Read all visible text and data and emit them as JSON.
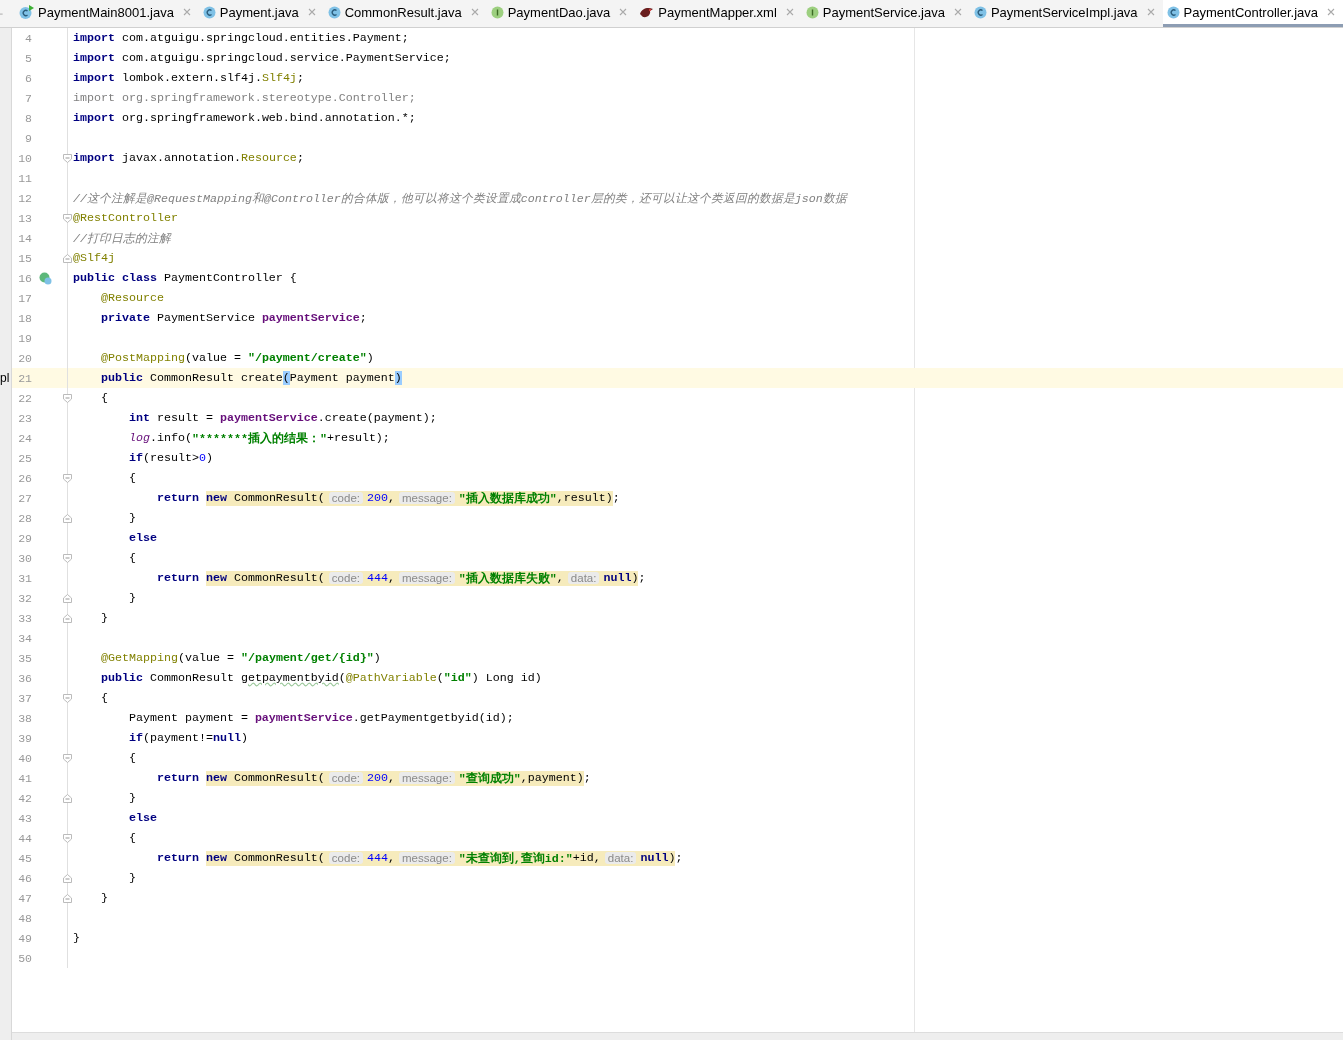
{
  "tabs": [
    {
      "label": "PaymentMain8001.java",
      "kind": "run",
      "selected": false
    },
    {
      "label": "Payment.java",
      "kind": "class",
      "selected": false
    },
    {
      "label": "CommonResult.java",
      "kind": "class",
      "selected": false
    },
    {
      "label": "PaymentDao.java",
      "kind": "interface",
      "selected": false
    },
    {
      "label": "PaymentMapper.xml",
      "kind": "xml",
      "selected": false
    },
    {
      "label": "PaymentService.java",
      "kind": "interface",
      "selected": false
    },
    {
      "label": "PaymentServiceImpl.java",
      "kind": "class",
      "selected": false
    },
    {
      "label": "PaymentController.java",
      "kind": "class",
      "selected": true
    }
  ],
  "editor": {
    "lines": [
      {
        "number": "4",
        "current": false,
        "tokens": [
          {
            "kind": "kw",
            "text": "import"
          },
          {
            "kind": "plain",
            "text": " com.atguigu.springcloud.entities.Payment;"
          }
        ]
      },
      {
        "number": "5",
        "current": false,
        "tokens": [
          {
            "kind": "kw",
            "text": "import"
          },
          {
            "kind": "plain",
            "text": " com.atguigu.springcloud.service.PaymentService;"
          }
        ]
      },
      {
        "number": "6",
        "current": false,
        "tokens": [
          {
            "kind": "kw",
            "text": "import"
          },
          {
            "kind": "plain",
            "text": " lombok.extern.slf4j."
          },
          {
            "kind": "ann",
            "text": "Slf4j"
          },
          {
            "kind": "plain",
            "text": ";"
          }
        ]
      },
      {
        "number": "7",
        "current": false,
        "tokens": [
          {
            "kind": "unused",
            "text": "import org.springframework.stereotype.Controller;"
          }
        ]
      },
      {
        "number": "8",
        "current": false,
        "tokens": [
          {
            "kind": "kw",
            "text": "import"
          },
          {
            "kind": "plain",
            "text": " org.springframework.web.bind.annotation.*;"
          }
        ]
      },
      {
        "number": "9",
        "current": false
      },
      {
        "number": "10",
        "current": false,
        "kind": "fold_start",
        "tokens": [
          {
            "kind": "kw",
            "text": "import"
          },
          {
            "kind": "plain",
            "text": " javax.annotation."
          },
          {
            "kind": "ann",
            "text": "Resource"
          },
          {
            "kind": "plain",
            "text": ";"
          }
        ]
      },
      {
        "number": "11",
        "current": false
      },
      {
        "number": "12",
        "current": false,
        "tokens": [
          {
            "kind": "comment",
            "text": "//这个注解是@RequestMapping和@Controller的合体版，他可以将这个类设置成controller层的类，还可以让这个类返回的数据是json数据"
          }
        ]
      },
      {
        "number": "13",
        "current": false,
        "kind": "fold_start",
        "tokens": [
          {
            "kind": "ann",
            "text": "@RestController"
          }
        ]
      },
      {
        "number": "14",
        "current": false,
        "tokens": [
          {
            "kind": "comment",
            "text": "//打印日志的注解"
          }
        ]
      },
      {
        "number": "15",
        "current": false,
        "kind": "fold_end",
        "tokens": [
          {
            "kind": "ann",
            "text": "@Slf4j"
          }
        ]
      },
      {
        "number": "16",
        "current": false,
        "kind": "class",
        "tokens": [
          {
            "kind": "kw",
            "text": "public class"
          },
          {
            "kind": "plain",
            "text": " PaymentController {"
          }
        ]
      },
      {
        "number": "17",
        "current": false,
        "tokens": [
          {
            "kind": "ann",
            "text": "    @Resource"
          }
        ]
      },
      {
        "number": "18",
        "current": false,
        "tokens": [
          {
            "kind": "kw",
            "text": "    private"
          },
          {
            "kind": "plain",
            "text": " PaymentService "
          },
          {
            "kind": "field",
            "text": "paymentService"
          },
          {
            "kind": "plain",
            "text": ";"
          }
        ]
      },
      {
        "number": "19",
        "current": false
      },
      {
        "number": "20",
        "current": false,
        "tokens": [
          {
            "kind": "ann",
            "text": "    @PostMapping"
          },
          {
            "kind": "plain",
            "text": "(value = "
          },
          {
            "kind": "str",
            "text": "\"/payment/create\""
          },
          {
            "kind": "plain",
            "text": ")"
          }
        ]
      },
      {
        "number": "21",
        "current": true,
        "side_text": "pl",
        "tokens": [
          {
            "kind": "kw",
            "text": "    public"
          },
          {
            "kind": "plain",
            "text": " CommonResult create"
          },
          {
            "kind": "brace",
            "text": "("
          },
          {
            "kind": "plain",
            "text": "Payment payment"
          },
          {
            "kind": "brace",
            "text": ")"
          }
        ]
      },
      {
        "number": "22",
        "current": false,
        "kind": "fold_start",
        "tokens": [
          {
            "kind": "plain",
            "text": "    {"
          }
        ]
      },
      {
        "number": "23",
        "current": false,
        "tokens": [
          {
            "kind": "kw",
            "text": "        int"
          },
          {
            "kind": "plain",
            "text": " result = "
          },
          {
            "kind": "field",
            "text": "paymentService"
          },
          {
            "kind": "plain",
            "text": ".create(payment);"
          }
        ]
      },
      {
        "number": "24",
        "current": false,
        "tokens": [
          {
            "kind": "static",
            "text": "        log"
          },
          {
            "kind": "plain",
            "text": ".info("
          },
          {
            "kind": "str",
            "text": "\"*******插入的结果：\""
          },
          {
            "kind": "plain",
            "text": "+result);"
          }
        ]
      },
      {
        "number": "25",
        "current": false,
        "tokens": [
          {
            "kind": "kw",
            "text": "        if"
          },
          {
            "kind": "plain",
            "text": "(result>"
          },
          {
            "kind": "num",
            "text": "0"
          },
          {
            "kind": "plain",
            "text": ")"
          }
        ]
      },
      {
        "number": "26",
        "current": false,
        "kind": "fold_start",
        "tokens": [
          {
            "kind": "plain",
            "text": "        {"
          }
        ]
      },
      {
        "number": "27",
        "current": false,
        "tokens": [
          {
            "kind": "kw",
            "text": "            return "
          },
          {
            "kind": "group",
            "tokens": [
              {
                "kind": "kw",
                "text": "new"
              },
              {
                "kind": "plain",
                "text": " CommonResult("
              },
              {
                "kind": "hint",
                "text": "code:"
              },
              {
                "kind": "num",
                "text": "200"
              },
              {
                "kind": "plain",
                "text": ","
              },
              {
                "kind": "hint",
                "text": "message:"
              },
              {
                "kind": "str",
                "text": "\"插入数据库成功\""
              },
              {
                "kind": "plain",
                "text": ",result)"
              }
            ]
          },
          {
            "kind": "plain",
            "text": ";"
          }
        ]
      },
      {
        "number": "28",
        "current": false,
        "kind": "fold_end",
        "tokens": [
          {
            "kind": "plain",
            "text": "        }"
          }
        ]
      },
      {
        "number": "29",
        "current": false,
        "tokens": [
          {
            "kind": "kw",
            "text": "        else"
          }
        ]
      },
      {
        "number": "30",
        "current": false,
        "kind": "fold_start",
        "tokens": [
          {
            "kind": "plain",
            "text": "        {"
          }
        ]
      },
      {
        "number": "31",
        "current": false,
        "tokens": [
          {
            "kind": "kw",
            "text": "            return "
          },
          {
            "kind": "group",
            "tokens": [
              {
                "kind": "kw",
                "text": "new"
              },
              {
                "kind": "plain",
                "text": " CommonResult("
              },
              {
                "kind": "hint",
                "text": "code:"
              },
              {
                "kind": "num",
                "text": "444"
              },
              {
                "kind": "plain",
                "text": ","
              },
              {
                "kind": "hint",
                "text": "message:"
              },
              {
                "kind": "str",
                "text": "\"插入数据库失败\""
              },
              {
                "kind": "plain",
                "text": ","
              },
              {
                "kind": "hint",
                "text": "data:"
              },
              {
                "kind": "kw",
                "text": "null"
              },
              {
                "kind": "plain",
                "text": ")"
              }
            ]
          },
          {
            "kind": "plain",
            "text": ";"
          }
        ]
      },
      {
        "number": "32",
        "current": false,
        "kind": "fold_end",
        "tokens": [
          {
            "kind": "plain",
            "text": "        }"
          }
        ]
      },
      {
        "number": "33",
        "current": false,
        "kind": "fold_end",
        "tokens": [
          {
            "kind": "plain",
            "text": "    }"
          }
        ]
      },
      {
        "number": "34",
        "current": false
      },
      {
        "number": "35",
        "current": false,
        "tokens": [
          {
            "kind": "ann",
            "text": "    @GetMapping"
          },
          {
            "kind": "plain",
            "text": "(value = "
          },
          {
            "kind": "str",
            "text": "\"/payment/get/{id}\""
          },
          {
            "kind": "plain",
            "text": ")"
          }
        ]
      },
      {
        "number": "36",
        "current": false,
        "tokens": [
          {
            "kind": "kw",
            "text": "    public"
          },
          {
            "kind": "plain",
            "text": " CommonResult "
          },
          {
            "kind": "typo",
            "text": "getpaymentbyid"
          },
          {
            "kind": "plain",
            "text": "("
          },
          {
            "kind": "ann",
            "text": "@PathVariable"
          },
          {
            "kind": "plain",
            "text": "("
          },
          {
            "kind": "str",
            "text": "\"id\""
          },
          {
            "kind": "plain",
            "text": ") Long id)"
          }
        ]
      },
      {
        "number": "37",
        "current": false,
        "kind": "fold_start",
        "tokens": [
          {
            "kind": "plain",
            "text": "    {"
          }
        ]
      },
      {
        "number": "38",
        "current": false,
        "tokens": [
          {
            "kind": "plain",
            "text": "        Payment payment = "
          },
          {
            "kind": "field",
            "text": "paymentService"
          },
          {
            "kind": "plain",
            "text": ".getPaymentgetbyid(id);"
          }
        ]
      },
      {
        "number": "39",
        "current": false,
        "tokens": [
          {
            "kind": "kw",
            "text": "        if"
          },
          {
            "kind": "plain",
            "text": "(payment!="
          },
          {
            "kind": "kw",
            "text": "null"
          },
          {
            "kind": "plain",
            "text": ")"
          }
        ]
      },
      {
        "number": "40",
        "current": false,
        "kind": "fold_start",
        "tokens": [
          {
            "kind": "plain",
            "text": "        {"
          }
        ]
      },
      {
        "number": "41",
        "current": false,
        "tokens": [
          {
            "kind": "kw",
            "text": "            return "
          },
          {
            "kind": "group",
            "tokens": [
              {
                "kind": "kw",
                "text": "new"
              },
              {
                "kind": "plain",
                "text": " CommonResult("
              },
              {
                "kind": "hint",
                "text": "code:"
              },
              {
                "kind": "num",
                "text": "200"
              },
              {
                "kind": "plain",
                "text": ","
              },
              {
                "kind": "hint",
                "text": "message:"
              },
              {
                "kind": "str",
                "text": "\"查询成功\""
              },
              {
                "kind": "plain",
                "text": ",payment)"
              }
            ]
          },
          {
            "kind": "plain",
            "text": ";"
          }
        ]
      },
      {
        "number": "42",
        "current": false,
        "kind": "fold_end",
        "tokens": [
          {
            "kind": "plain",
            "text": "        }"
          }
        ]
      },
      {
        "number": "43",
        "current": false,
        "tokens": [
          {
            "kind": "kw",
            "text": "        else"
          }
        ]
      },
      {
        "number": "44",
        "current": false,
        "kind": "fold_start",
        "tokens": [
          {
            "kind": "plain",
            "text": "        {"
          }
        ]
      },
      {
        "number": "45",
        "current": false,
        "tokens": [
          {
            "kind": "kw",
            "text": "            return "
          },
          {
            "kind": "group",
            "tokens": [
              {
                "kind": "kw",
                "text": "new"
              },
              {
                "kind": "plain",
                "text": " CommonResult("
              },
              {
                "kind": "hint",
                "text": "code:"
              },
              {
                "kind": "num",
                "text": "444"
              },
              {
                "kind": "plain",
                "text": ","
              },
              {
                "kind": "hint",
                "text": "message:"
              },
              {
                "kind": "str",
                "text": "\"未查询到,查询id:\""
              },
              {
                "kind": "plain",
                "text": "+id,"
              },
              {
                "kind": "hint",
                "text": "data:"
              },
              {
                "kind": "kw",
                "text": "null"
              },
              {
                "kind": "plain",
                "text": ")"
              }
            ]
          },
          {
            "kind": "plain",
            "text": ";"
          }
        ]
      },
      {
        "number": "46",
        "current": false,
        "kind": "fold_end",
        "tokens": [
          {
            "kind": "plain",
            "text": "        }"
          }
        ]
      },
      {
        "number": "47",
        "current": false,
        "kind": "fold_end",
        "tokens": [
          {
            "kind": "plain",
            "text": "    }"
          }
        ]
      },
      {
        "number": "48",
        "current": false
      },
      {
        "number": "49",
        "current": false,
        "tokens": [
          {
            "kind": "plain",
            "text": "}"
          }
        ]
      },
      {
        "number": "50",
        "current": false
      }
    ]
  }
}
